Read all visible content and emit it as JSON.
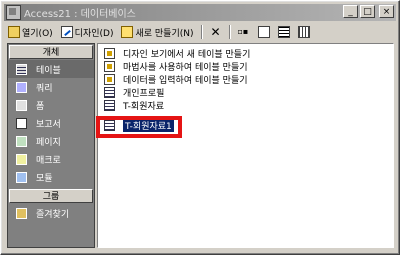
{
  "window": {
    "title": "Access21 : 데이터베이스",
    "controls": {
      "minimize": "_",
      "maximize": "□",
      "close": "×"
    }
  },
  "toolbar": {
    "open_label": "열기(O)",
    "design_label": "디자인(D)",
    "new_label": "새로 만들기(N)",
    "delete_icon": "delete-icon",
    "view_icons": [
      "large-icons-icon",
      "small-icons-icon",
      "list-view-icon",
      "details-view-icon"
    ]
  },
  "sidebar": {
    "objects_header": "개체",
    "items": [
      {
        "label": "테이블",
        "icon": "table-icon"
      },
      {
        "label": "쿼리",
        "icon": "query-icon"
      },
      {
        "label": "폼",
        "icon": "form-icon"
      },
      {
        "label": "보고서",
        "icon": "report-icon"
      },
      {
        "label": "페이지",
        "icon": "page-icon"
      },
      {
        "label": "매크로",
        "icon": "macro-icon"
      },
      {
        "label": "모듈",
        "icon": "module-icon"
      }
    ],
    "groups_header": "그룹",
    "group_items": [
      {
        "label": "즐겨찾기",
        "icon": "favorites-icon"
      }
    ],
    "active_item": "테이블"
  },
  "objects": [
    {
      "label": "디자인 보기에서 새 테이블 만들기",
      "type": "shortcut"
    },
    {
      "label": "마법사를 사용하여 테이블 만들기",
      "type": "shortcut"
    },
    {
      "label": "데이터를 입력하여 테이블 만들기",
      "type": "shortcut"
    },
    {
      "label": "개인프로필",
      "type": "table"
    },
    {
      "label": "T-회원자료",
      "type": "table"
    },
    {
      "label": "T-회원자료1",
      "type": "table",
      "selected": true
    }
  ],
  "colors": {
    "highlight_box": "#e51414",
    "selection": "#0a246a",
    "sidebar_bg": "#808080"
  }
}
